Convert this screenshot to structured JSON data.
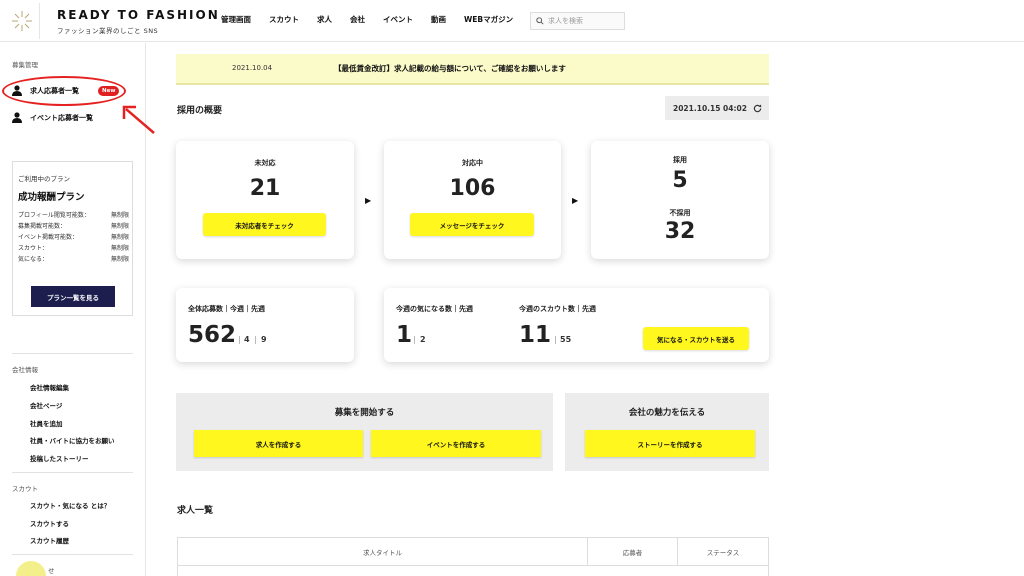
{
  "header": {
    "brand_title": "READY TO FASHION",
    "brand_sub": "ファッション業界のしごと SNS",
    "nav": [
      "管理画面",
      "スカウト",
      "求人",
      "会社",
      "イベント",
      "動画",
      "WEBマガジン"
    ],
    "search_placeholder": "求人を検索"
  },
  "sidebar": {
    "recruit_section": "募集管理",
    "applicants_link": "求人応募者一覧",
    "new_badge": "New",
    "event_applicants_link": "イベント応募者一覧",
    "plan": {
      "caption": "ご利用中のプラン",
      "name": "成功報酬プラン",
      "rows": [
        {
          "label": "プロフィール閲覧可能数：",
          "value": "無制限"
        },
        {
          "label": "募集掲載可能数：",
          "value": "無制限"
        },
        {
          "label": "イベント掲載可能数：",
          "value": "無制限"
        },
        {
          "label": "スカウト：",
          "value": "無制限"
        },
        {
          "label": "気になる：",
          "value": "無制限"
        }
      ],
      "button": "プラン一覧を見る"
    },
    "company_section": "会社情報",
    "company_links": [
      "会社情報編集",
      "会社ページ",
      "社員を追加",
      "社員・バイトに協力をお願い",
      "投稿したストーリー"
    ],
    "scout_section": "スカウト",
    "scout_links": [
      "スカウト・気になる とは？",
      "スカウトする",
      "スカウト履歴"
    ],
    "bottom_partial": "せ"
  },
  "notice": {
    "date": "2021.10.04",
    "text": "【最低賃金改訂】求人記載の給与額について、ご確認をお願いします"
  },
  "overview": {
    "title": "採用の概要",
    "timestamp": "2021.10.15 04:02",
    "unhandled": {
      "label": "未対応",
      "count": "21",
      "button": "未対応者をチェック"
    },
    "in_progress": {
      "label": "対応中",
      "count": "106",
      "button": "メッセージをチェック"
    },
    "hired": {
      "label": "採用",
      "count": "5"
    },
    "rejected": {
      "label": "不採用",
      "count": "32"
    }
  },
  "stats": {
    "total_label": "全体応募数｜今週｜先週",
    "total": "562",
    "total_week": "4",
    "total_last": "9",
    "fav_label": "今週の気になる数｜先週",
    "fav": "1",
    "fav_last": "2",
    "scout_label": "今週のスカウト数｜先週",
    "scout": "11",
    "scout_last": "55",
    "send_button": "気になる・スカウトを送る"
  },
  "actions": {
    "start_title": "募集を開始する",
    "create_job": "求人を作成する",
    "create_event": "イベントを作成する",
    "appeal_title": "会社の魅力を伝える",
    "create_story": "ストーリーを作成する"
  },
  "jobs": {
    "title": "求人一覧",
    "columns": [
      "求人タイトル",
      "応募者",
      "ステータス"
    ]
  }
}
